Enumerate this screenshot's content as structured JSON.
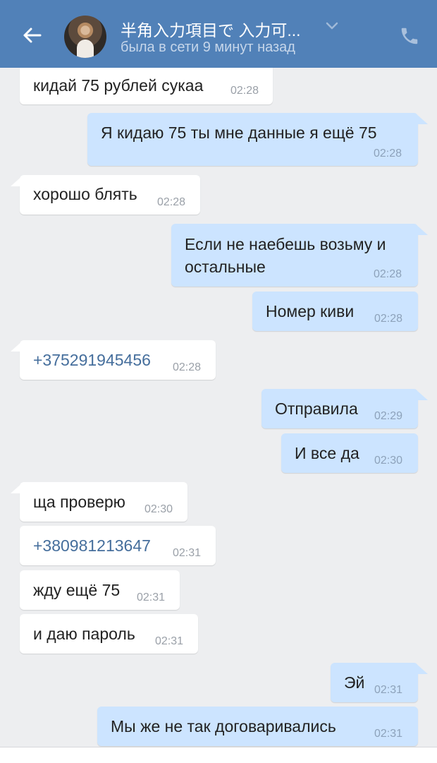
{
  "header": {
    "title": "半角入力項目で 入力可...",
    "status": "была в сети 9 минут назад",
    "back_icon": "arrow-left-icon",
    "call_icon": "phone-icon",
    "dropdown_icon": "chevron-down-icon"
  },
  "colors": {
    "header": "#5181b8",
    "background": "#edeef0",
    "incoming_bubble": "#ffffff",
    "outgoing_bubble": "#cce4ff",
    "link": "#456e9c"
  },
  "messages": [
    {
      "dir": "in",
      "text": "кидай 75 рублей сукаа",
      "time": "02:28"
    },
    {
      "dir": "out",
      "text": "Я кидаю 75 ты мне данные я ещё 75",
      "time": "02:28"
    },
    {
      "dir": "in",
      "text": "хорошо блять",
      "time": "02:28"
    },
    {
      "dir": "out",
      "text_line1": "Если не наебешь возьму и",
      "text_line2": "остальные",
      "time": "02:28"
    },
    {
      "dir": "out",
      "text": "Номер киви",
      "time": "02:28"
    },
    {
      "dir": "in",
      "text": "+375291945456",
      "time": "02:28"
    },
    {
      "dir": "out",
      "text": "Отправила",
      "time": "02:29"
    },
    {
      "dir": "out",
      "text": "И все да",
      "time": "02:30"
    },
    {
      "dir": "in",
      "text": "ща проверю",
      "time": "02:30"
    },
    {
      "dir": "in",
      "text": "+380981213647",
      "time": "02:31"
    },
    {
      "dir": "in",
      "text": "жду ещё 75",
      "time": "02:31"
    },
    {
      "dir": "in",
      "text": "и даю пароль",
      "time": "02:31"
    },
    {
      "dir": "out",
      "text": "Эй",
      "time": "02:31"
    },
    {
      "dir": "out",
      "text": "Мы же не так договаривались",
      "time": "02:31"
    }
  ]
}
